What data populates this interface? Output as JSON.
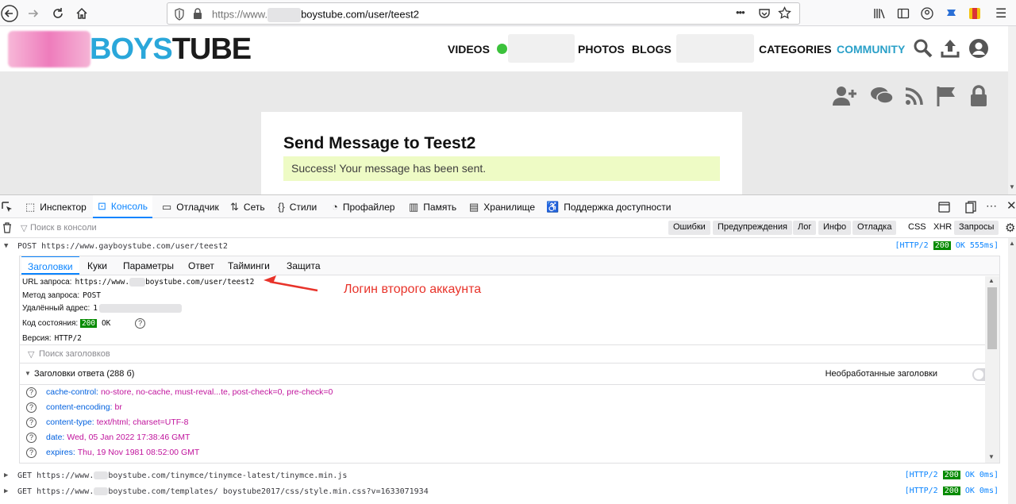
{
  "browser": {
    "url_prefix": "https://www.",
    "url_suffix": "boystube.com/user/teest2",
    "menu_dots": "•••"
  },
  "site": {
    "logo_boys": "BOYS",
    "logo_tube": "TUBE",
    "nav": {
      "videos": "VIDEOS",
      "photos": "PHOTOS",
      "blogs": "BLOGS",
      "categories": "CATEGORIES",
      "community": "COMMUNITY"
    },
    "panel_title": "Send Message to Teest2",
    "success_message": "Success! Your message has been sent."
  },
  "devtools": {
    "tabs": [
      "Инспектор",
      "Консоль",
      "Отладчик",
      "Сеть",
      "Стили",
      "Профайлер",
      "Память",
      "Хранилище",
      "Поддержка доступности"
    ],
    "filter_placeholder": "Поиск в консоли",
    "filters": [
      "Ошибки",
      "Предупреждения",
      "Лог",
      "Инфо",
      "Отладка",
      "CSS",
      "XHR",
      "Запросы"
    ],
    "request_main": {
      "method": "POST",
      "url": "https://www.gayboystube.com/user/teest2",
      "status": "[HTTP/2",
      "code": "200",
      "status_tail": "OK 555ms]"
    },
    "detail_tabs": [
      "Заголовки",
      "Куки",
      "Параметры",
      "Ответ",
      "Тайминги",
      "Защита"
    ],
    "details": {
      "url_label": "URL запроса:",
      "url_value_prefix": "https://www.",
      "url_value_suffix": "boystube.com/user/teest2",
      "method_label": "Метод запроса:",
      "method_value": "POST",
      "remote_label": "Удалённый адрес:",
      "remote_value": "1",
      "status_label": "Код состояния:",
      "status_code": "200",
      "status_text": "OK",
      "version_label": "Версия:",
      "version_value": "HTTP/2",
      "header_filter_placeholder": "Поиск заголовков",
      "response_headers_title": "Заголовки ответа (288 б)",
      "raw_headers_label": "Необработанные заголовки"
    },
    "headers": [
      {
        "key": "cache-control:",
        "value": "no-store, no-cache, must-reval...te, post-check=0, pre-check=0"
      },
      {
        "key": "content-encoding:",
        "value": "br"
      },
      {
        "key": "content-type:",
        "value": "text/html; charset=UTF-8"
      },
      {
        "key": "date:",
        "value": "Wed, 05 Jan 2022 17:38:46 GMT"
      },
      {
        "key": "expires:",
        "value": "Thu, 19 Nov 1981 08:52:00 GMT"
      }
    ],
    "requests": [
      {
        "method": "GET",
        "url_prefix": "https://www.",
        "url_suffix": "boystube.com/tinymce/tinymce-latest/tinymce.min.js",
        "status": "[HTTP/2",
        "code": "200",
        "tail": "OK 0ms]"
      },
      {
        "method": "GET",
        "url_prefix": "https://www.",
        "url_suffix": "boystube.com/templates/      boystube2017/css/style.min.css?v=1633071934",
        "status": "[HTTP/2",
        "code": "200",
        "tail": "OK 0ms]"
      }
    ],
    "annotation": "Логин второго аккаунта"
  },
  "colors": {
    "accent": "#0a84ff",
    "logo_blue": "#2aa7da",
    "success_bg": "#eefbc5",
    "annotation_red": "#e8332a",
    "status_green": "#058b00"
  }
}
